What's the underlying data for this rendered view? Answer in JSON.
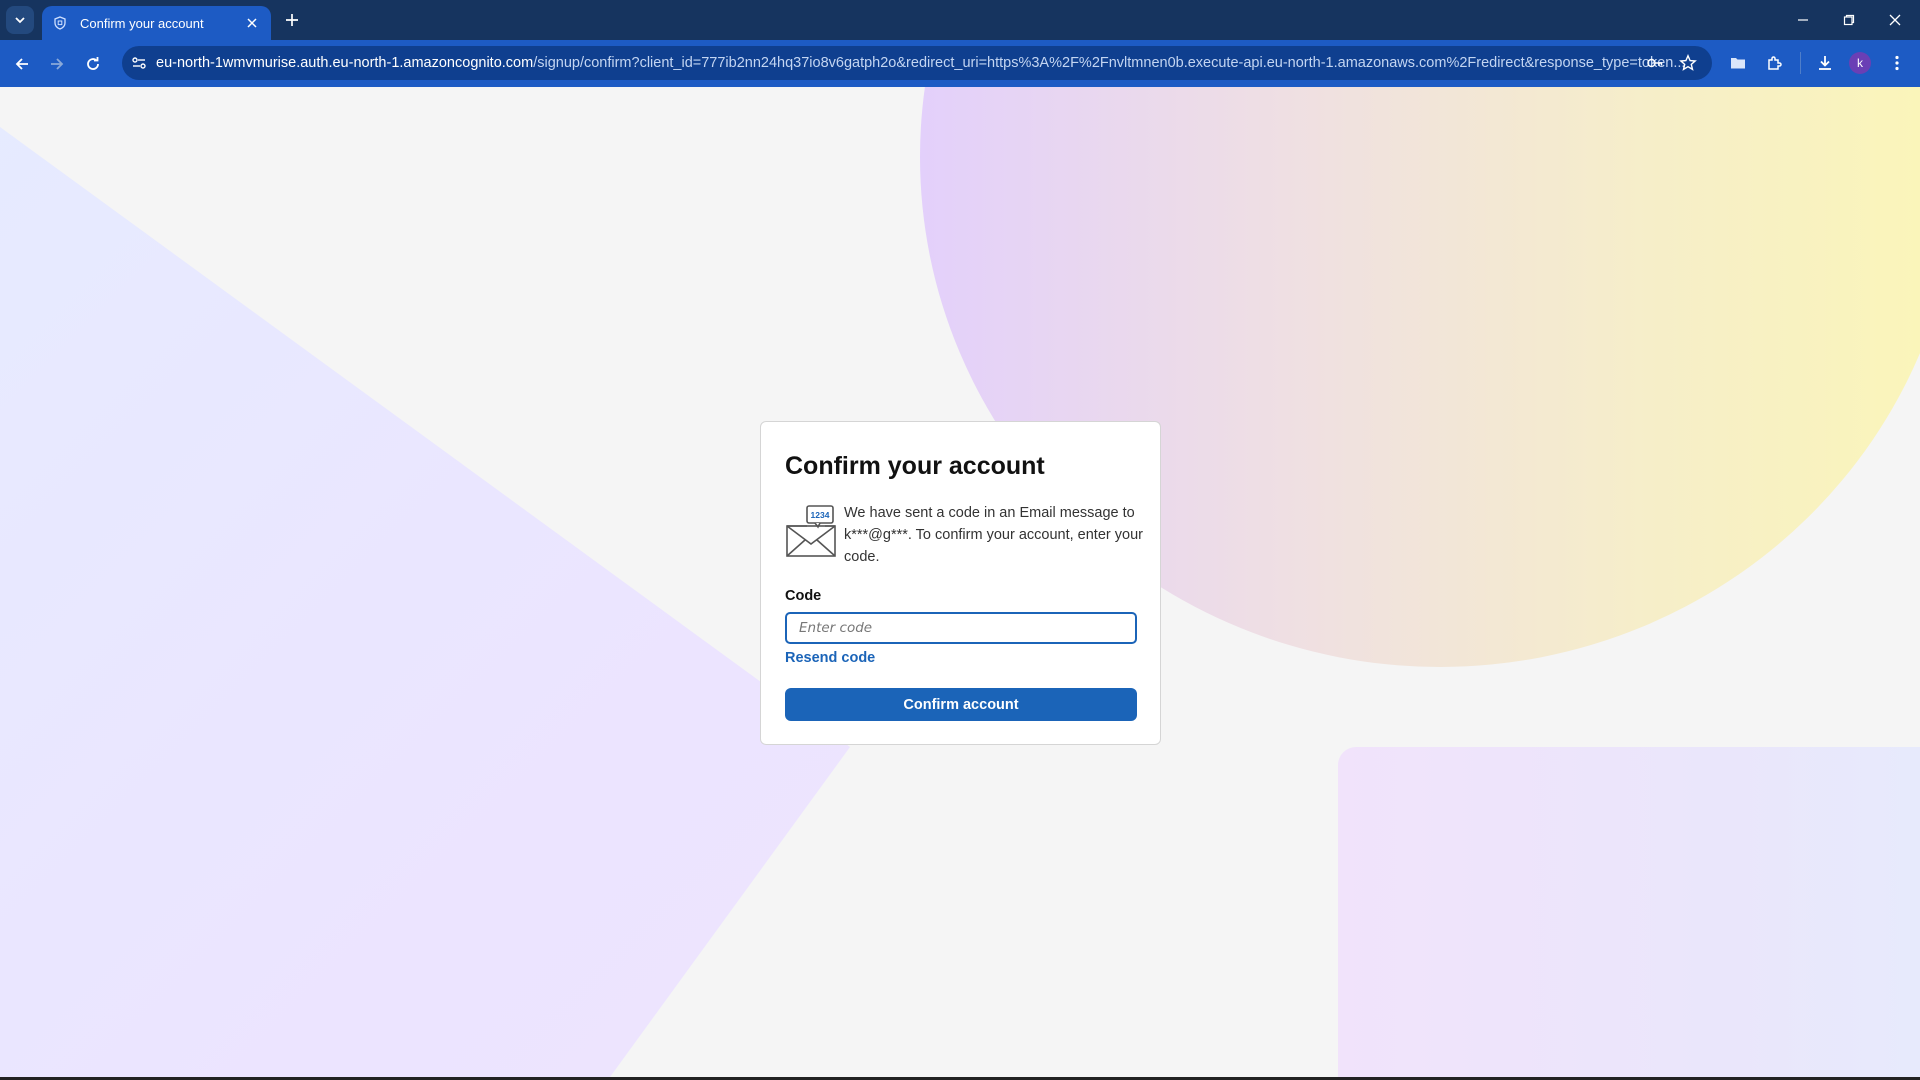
{
  "browser": {
    "tab_title": "Confirm your account",
    "url_host": "eu-north-1wmvmurise.auth.eu-north-1.amazoncognito.com",
    "url_path": "/signup/confirm?client_id=777ib2nn24hq37io8v6gatph2o&redirect_uri=https%3A%2F%2Fnvltmnen0b.execute-api.eu-north-1.amazonaws.com%2Fredirect&response_type=token...",
    "profile_initial": "k"
  },
  "card": {
    "title": "Confirm your account",
    "message": "We have sent a code in an Email message to k***@g***. To confirm your account, enter your code.",
    "icon_badge": "1234",
    "code_label": "Code",
    "code_placeholder": "Enter code",
    "code_value": "",
    "resend_label": "Resend code",
    "confirm_label": "Confirm account"
  },
  "colors": {
    "chrome_dark": "#16345f",
    "chrome_toolbar": "#1d5bc4",
    "primary": "#1b64b8",
    "page_background": "#f5f5f5"
  }
}
